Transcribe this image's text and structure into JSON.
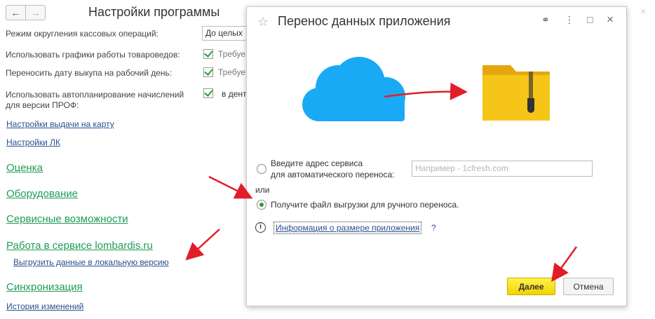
{
  "nav": {
    "back": "←",
    "forward": "→"
  },
  "main": {
    "title": "Настройки программы",
    "rows": {
      "rounding_label": "Режим округления кассовых операций:",
      "rounding_value": "До целых",
      "schedules_label": "Использовать графики работы товароведов:",
      "schedules_value": "Требуе",
      "buyout_label": "Переносить дату выкупа на рабочий день:",
      "buyout_value": "Требуе",
      "autoplan_label_1": "Использовать автопланирование начислений",
      "autoplan_label_2": "для версии ПРОФ:",
      "autoplan_value": "в дент"
    },
    "links": {
      "card_settings": "Настройки выдачи на карту",
      "lk_settings": "Настройки ЛК",
      "export_local": "Выгрузить данные в локальную версию",
      "history": "История изменений"
    },
    "sections": {
      "valuation": "Оценка",
      "equipment": "Оборудование",
      "service": "Сервисные возможности",
      "lombardis": "Работа в сервисе lombardis.ru",
      "sync": "Синхронизация"
    }
  },
  "dialog": {
    "title": "Перенос данных приложения",
    "controls": {
      "link": "⚭",
      "more": "⋮",
      "maximize": "□",
      "close": "×"
    },
    "option_auto_1": "Введите адрес сервиса",
    "option_auto_2": "для автоматического переноса:",
    "service_placeholder": "Например - 1cfresh.com",
    "or": "или",
    "option_manual": "Получите файл выгрузки для ручного переноса.",
    "info_icon": "i",
    "info_link": "Информация о размере приложения",
    "help": "?",
    "ok": "Далее",
    "cancel": "Отмена",
    "selected_option": "manual"
  },
  "outer_close": "×",
  "colors": {
    "cloud": "#1aaaf5",
    "folder": "#f5c518",
    "arrow": "#e11d2a",
    "section_link": "#1f9b54",
    "link": "#2a4f8f",
    "primary_button": "#f1d400"
  }
}
